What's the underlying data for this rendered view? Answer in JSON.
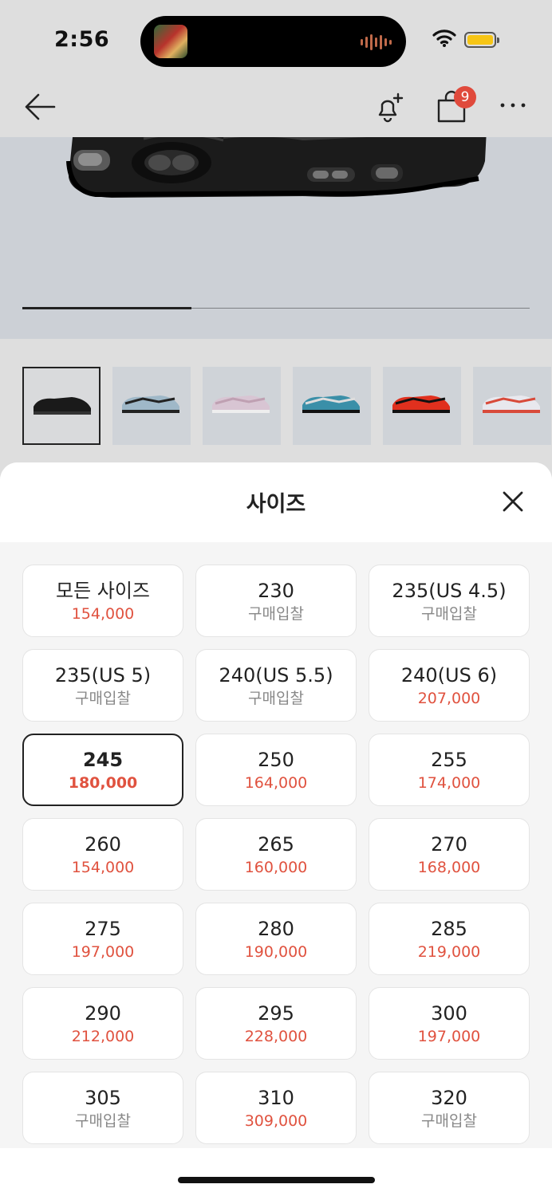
{
  "status_bar": {
    "time": "2:56",
    "battery_color": "#f6c515"
  },
  "nav": {
    "cart_count": "9",
    "icons": [
      "back-arrow-icon",
      "alarm-add-icon",
      "shopping-bag-icon",
      "more-icon"
    ]
  },
  "gallery": {
    "progress": 0.333,
    "thumbnails": [
      {
        "name": "black",
        "colors": [
          "#1a1a1a",
          "#333333"
        ]
      },
      {
        "name": "grey-blue",
        "colors": [
          "#9fb8c8",
          "#222222"
        ]
      },
      {
        "name": "pink",
        "colors": [
          "#d8c5d3",
          "#bfa0b2"
        ]
      },
      {
        "name": "teal",
        "colors": [
          "#3a8fa8",
          "#111111"
        ]
      },
      {
        "name": "red",
        "colors": [
          "#e0301e",
          "#111111"
        ]
      },
      {
        "name": "white-red",
        "colors": [
          "#e8e8ee",
          "#d84a3a"
        ]
      }
    ]
  },
  "sheet": {
    "title": "사이즈",
    "sizes": [
      {
        "label": "모든 사이즈",
        "price": "154,000",
        "bid": false,
        "selected": false
      },
      {
        "label": "230",
        "price": "구매입찰",
        "bid": true,
        "selected": false
      },
      {
        "label": "235(US 4.5)",
        "price": "구매입찰",
        "bid": true,
        "selected": false
      },
      {
        "label": "235(US 5)",
        "price": "구매입찰",
        "bid": true,
        "selected": false
      },
      {
        "label": "240(US 5.5)",
        "price": "구매입찰",
        "bid": true,
        "selected": false
      },
      {
        "label": "240(US 6)",
        "price": "207,000",
        "bid": false,
        "selected": false
      },
      {
        "label": "245",
        "price": "180,000",
        "bid": false,
        "selected": true
      },
      {
        "label": "250",
        "price": "164,000",
        "bid": false,
        "selected": false
      },
      {
        "label": "255",
        "price": "174,000",
        "bid": false,
        "selected": false
      },
      {
        "label": "260",
        "price": "154,000",
        "bid": false,
        "selected": false
      },
      {
        "label": "265",
        "price": "160,000",
        "bid": false,
        "selected": false
      },
      {
        "label": "270",
        "price": "168,000",
        "bid": false,
        "selected": false
      },
      {
        "label": "275",
        "price": "197,000",
        "bid": false,
        "selected": false
      },
      {
        "label": "280",
        "price": "190,000",
        "bid": false,
        "selected": false
      },
      {
        "label": "285",
        "price": "219,000",
        "bid": false,
        "selected": false
      },
      {
        "label": "290",
        "price": "212,000",
        "bid": false,
        "selected": false
      },
      {
        "label": "295",
        "price": "228,000",
        "bid": false,
        "selected": false
      },
      {
        "label": "300",
        "price": "197,000",
        "bid": false,
        "selected": false
      },
      {
        "label": "305",
        "price": "구매입찰",
        "bid": true,
        "selected": false
      },
      {
        "label": "310",
        "price": "309,000",
        "bid": false,
        "selected": false
      },
      {
        "label": "320",
        "price": "구매입찰",
        "bid": true,
        "selected": false
      }
    ]
  },
  "colors": {
    "price": "#e0523f",
    "bid": "#888888",
    "badge": "#e04a3c"
  }
}
